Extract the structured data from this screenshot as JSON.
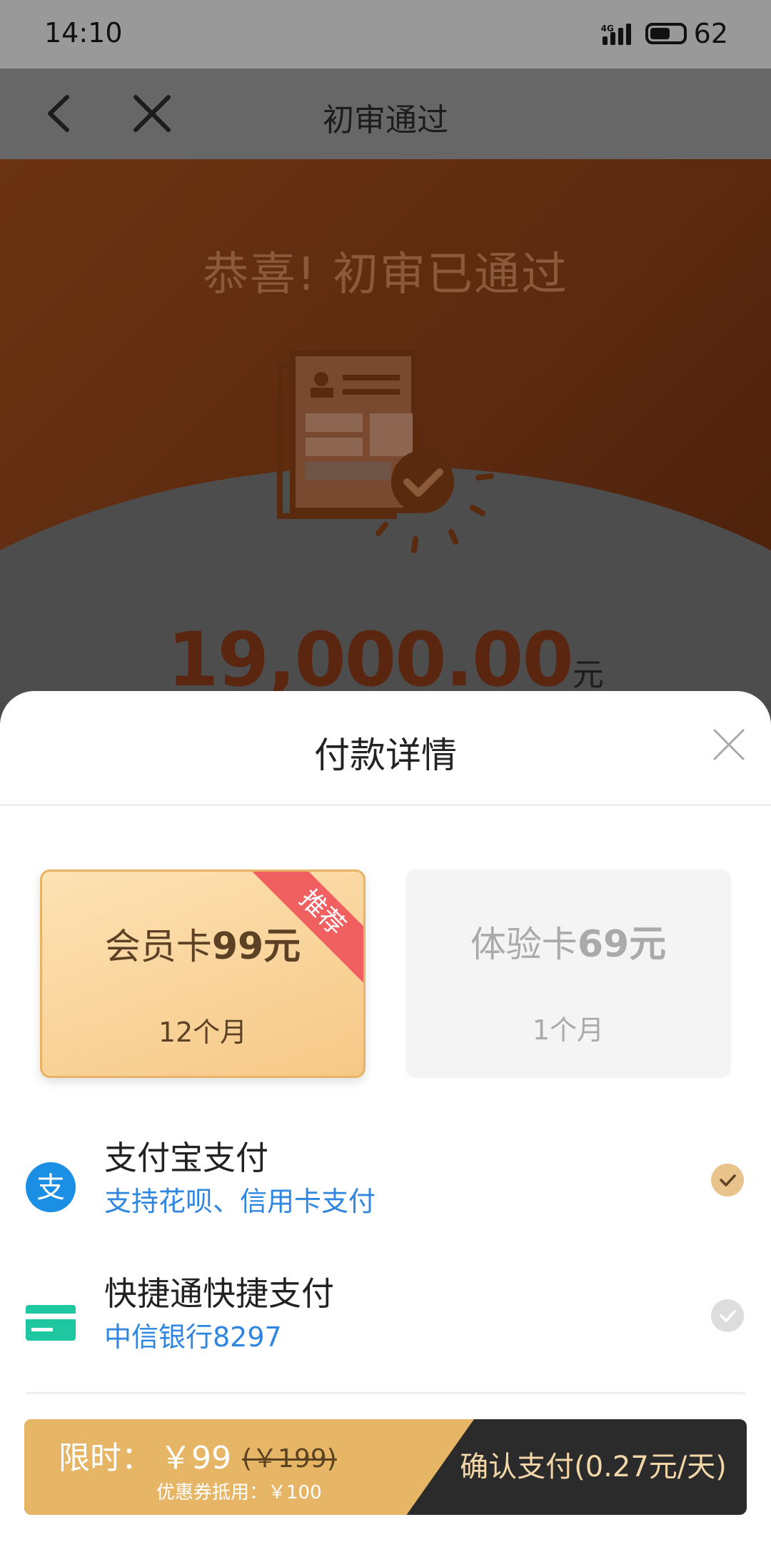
{
  "status_bar": {
    "time": "14:10",
    "network": "4G",
    "battery": "62"
  },
  "nav": {
    "title": "初审通过"
  },
  "hero": {
    "title": "恭喜! 初审已通过",
    "amount": "19,000.00",
    "amount_unit": "元"
  },
  "sheet": {
    "title": "付款详情",
    "cards": [
      {
        "name_prefix": "会员卡",
        "name_price": "99元",
        "period": "12个月",
        "badge": "推荐",
        "selected": true
      },
      {
        "name_prefix": "体验卡",
        "name_price": "69元",
        "period": "1个月",
        "selected": false
      }
    ],
    "payments": [
      {
        "name": "支付宝支付",
        "sub": "支持花呗、信用卡支付",
        "icon": "alipay-icon",
        "selected": true
      },
      {
        "name": "快捷通快捷支付",
        "sub": "中信银行8297",
        "icon": "bank-card-icon",
        "selected": false
      }
    ]
  },
  "pay_bar": {
    "limit_label": "限时：",
    "price": "￥99",
    "original_price": "(￥199)",
    "coupon": "优惠券抵用：￥100",
    "confirm": "确认支付(0.27元/天)"
  },
  "colors": {
    "accent_gold": "#e6b566",
    "link_blue": "#2f86e0",
    "alipay_blue": "#1a8fe3",
    "bank_green": "#1fc7a0",
    "badge_red": "#f06060"
  }
}
